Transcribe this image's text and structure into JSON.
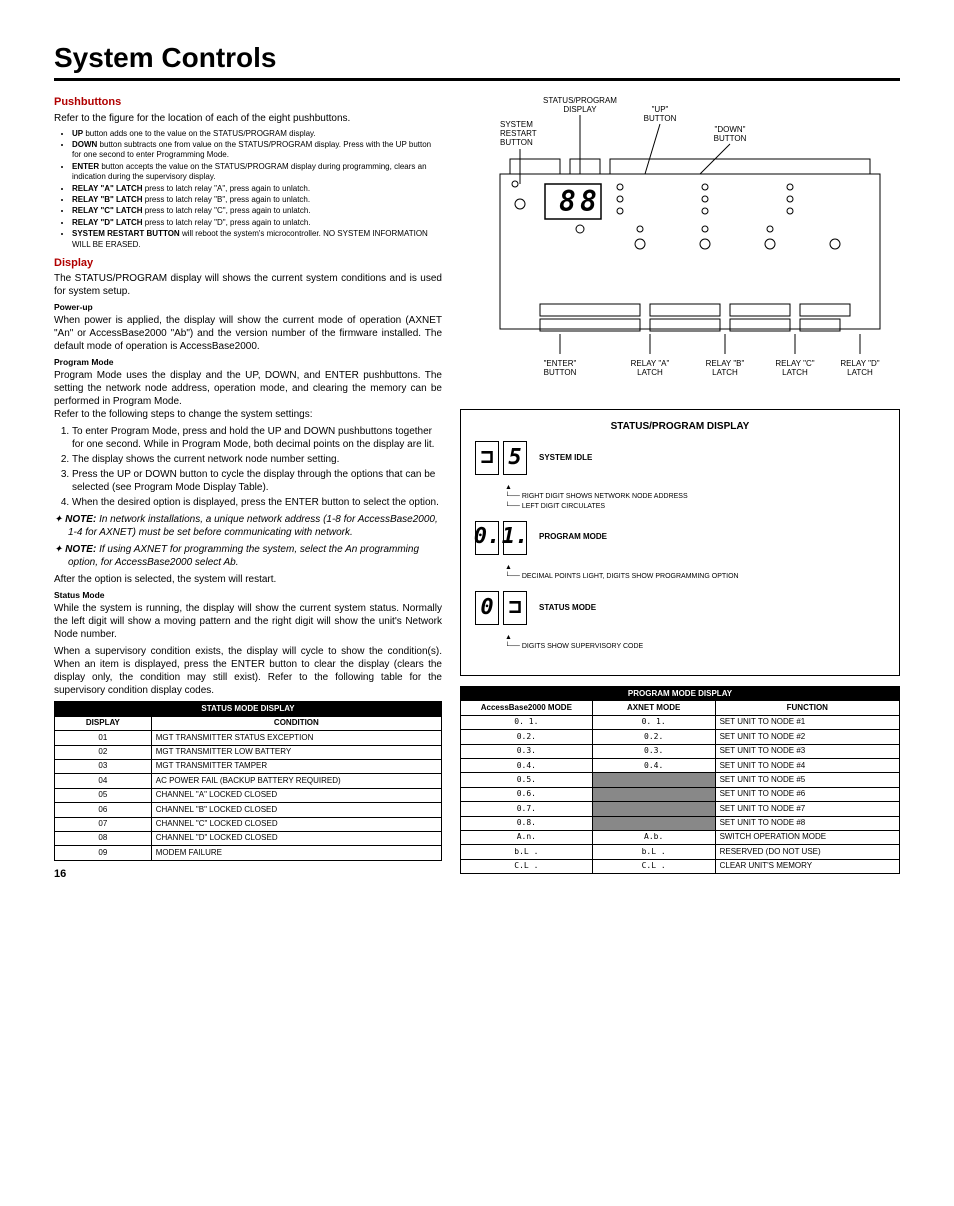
{
  "title": "System Controls",
  "page_no": "16",
  "pushbuttons": {
    "heading": "Pushbuttons",
    "intro": "Refer to the figure for the location of each of the eight pushbuttons.",
    "items": [
      {
        "b": "UP",
        "t": " button adds one to the value on the STATUS/PROGRAM display."
      },
      {
        "b": "DOWN",
        "t": " button subtracts one from value on the STATUS/PROGRAM display. Press with the UP button for one second to enter Programming Mode."
      },
      {
        "b": "ENTER",
        "t": " button accepts the value on the STATUS/PROGRAM display during programming, clears an indication during the supervisory display."
      },
      {
        "b": "RELAY \"A\" LATCH",
        "t": " press to latch relay \"A\", press again to unlatch."
      },
      {
        "b": "RELAY \"B\" LATCH",
        "t": " press to latch relay \"B\", press again to unlatch."
      },
      {
        "b": "RELAY \"C\" LATCH",
        "t": " press to latch relay \"C\", press again to unlatch."
      },
      {
        "b": "RELAY \"D\" LATCH",
        "t": " press to latch relay \"D\", press again to unlatch."
      },
      {
        "b": "SYSTEM RESTART BUTTON",
        "t": " will reboot the system's microcontroller. NO SYSTEM INFORMATION WILL BE ERASED."
      }
    ]
  },
  "display": {
    "heading": "Display",
    "intro": "The STATUS/PROGRAM display will shows the current system conditions and is used for system setup.",
    "powerup_h": "Power-up",
    "powerup_t": "When power is applied, the display will show the current mode of operation (AXNET \"An\" or AccessBase2000 \"Ab\") and the version number of the firmware installed. The default mode of operation is AccessBase2000.",
    "program_h": "Program Mode",
    "program_t1": "Program Mode uses the display and the UP, DOWN, and ENTER pushbuttons. The setting the network node address, operation mode, and clearing the memory can be performed in Program Mode.",
    "program_t2": "Refer to the following steps to change the system settings:",
    "steps": [
      "To enter Program Mode, press and hold the UP and DOWN pushbuttons together for one second. While in Program Mode, both decimal points on the display are lit.",
      "The display shows the current network node number setting.",
      "Press the UP or DOWN button to cycle the display through the options that can be selected (see Program Mode Display Table).",
      "When the desired option is displayed, press the ENTER button to select the option."
    ],
    "note1": "In network installations, a unique network address (1-8 for AccessBase2000, 1-4 for AXNET) must be set before communicating with network.",
    "note2": "If using AXNET for programming the system, select the An programming option, for AccessBase2000 select Ab.",
    "after": "After the option is selected, the system will restart.",
    "status_h": "Status Mode",
    "status_t1": "While the system is running, the display will show the current system status. Normally the left digit will show a moving pattern and the right digit will show the unit's Network Node number.",
    "status_t2": "When a supervisory condition exists, the display will cycle to show the condition(s). When an item is displayed, press the ENTER button to clear the display (clears the display only, the condition may still exist). Refer to the following table for the supervisory condition display codes."
  },
  "status_table": {
    "title": "STATUS MODE DISPLAY",
    "h1": "DISPLAY",
    "h2": "CONDITION",
    "rows": [
      {
        "d": "01",
        "c": "MGT TRANSMITTER STATUS EXCEPTION"
      },
      {
        "d": "02",
        "c": "MGT TRANSMITTER LOW BATTERY"
      },
      {
        "d": "03",
        "c": "MGT TRANSMITTER TAMPER"
      },
      {
        "d": "04",
        "c": "AC POWER FAIL (BACKUP BATTERY REQUIRED)"
      },
      {
        "d": "05",
        "c": "CHANNEL \"A\" LOCKED CLOSED"
      },
      {
        "d": "06",
        "c": "CHANNEL \"B\" LOCKED CLOSED"
      },
      {
        "d": "07",
        "c": "CHANNEL \"C\" LOCKED CLOSED"
      },
      {
        "d": "08",
        "c": "CHANNEL \"D\" LOCKED CLOSED"
      },
      {
        "d": "09",
        "c": "MODEM FAILURE"
      }
    ]
  },
  "figure": {
    "labels": {
      "sp": "STATUS/PROGRAM DISPLAY",
      "up": "\"UP\" BUTTON",
      "restart": "SYSTEM RESTART BUTTON",
      "down": "\"DOWN\" BUTTON",
      "enter": "\"ENTER\" BUTTON",
      "ra": "RELAY \"A\" LATCH",
      "rb": "RELAY \"B\" LATCH",
      "rc": "RELAY \"C\" LATCH",
      "rd": "RELAY \"D\" LATCH"
    }
  },
  "status_program": {
    "title": "STATUS/PROGRAM DISPLAY",
    "idle": "SYSTEM IDLE",
    "idle_n1": "RIGHT DIGIT SHOWS NETWORK NODE ADDRESS",
    "idle_n2": "LEFT DIGIT CIRCULATES",
    "prog": "PROGRAM MODE",
    "prog_n": "DECIMAL POINTS LIGHT, DIGITS SHOW PROGRAMMING OPTION",
    "stat": "STATUS MODE",
    "stat_n": "DIGITS SHOW SUPERVISORY CODE"
  },
  "program_table": {
    "title": "PROGRAM MODE DISPLAY",
    "h1": "AccessBase2000 MODE",
    "h2": "AXNET MODE",
    "h3": "FUNCTION",
    "rows": [
      {
        "a": "0. 1.",
        "x": "0. 1.",
        "f": "SET UNIT TO NODE #1"
      },
      {
        "a": "0.2.",
        "x": "0.2.",
        "f": "SET UNIT TO NODE #2"
      },
      {
        "a": "0.3.",
        "x": "0.3.",
        "f": "SET UNIT TO NODE #3"
      },
      {
        "a": "0.4.",
        "x": "0.4.",
        "f": "SET UNIT TO NODE #4"
      },
      {
        "a": "0.5.",
        "x": "",
        "f": "SET UNIT TO NODE #5",
        "s": true
      },
      {
        "a": "0.6.",
        "x": "",
        "f": "SET UNIT TO NODE #6",
        "s": true
      },
      {
        "a": "0.7.",
        "x": "",
        "f": "SET UNIT TO NODE #7",
        "s": true
      },
      {
        "a": "0.8.",
        "x": "",
        "f": "SET UNIT TO NODE #8",
        "s": true
      },
      {
        "a": "A.n.",
        "x": "A.b.",
        "f": "SWITCH OPERATION MODE"
      },
      {
        "a": "b.L .",
        "x": "b.L .",
        "f": "RESERVED (DO NOT USE)"
      },
      {
        "a": "C.L .",
        "x": "C.L .",
        "f": "CLEAR UNIT'S MEMORY"
      }
    ]
  }
}
